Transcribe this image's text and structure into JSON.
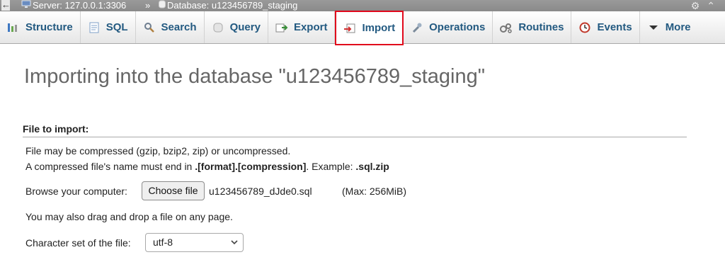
{
  "breadcrumb": {
    "server": "Server: 127.0.0.1:3306",
    "separator": "»",
    "database": "Database: u123456789_staging"
  },
  "tabs": [
    {
      "label": "Structure",
      "icon": "structure-icon"
    },
    {
      "label": "SQL",
      "icon": "sql-icon"
    },
    {
      "label": "Search",
      "icon": "search-icon"
    },
    {
      "label": "Query",
      "icon": "query-icon"
    },
    {
      "label": "Export",
      "icon": "export-icon"
    },
    {
      "label": "Import",
      "icon": "import-icon",
      "active": true
    },
    {
      "label": "Operations",
      "icon": "wrench-icon"
    },
    {
      "label": "Routines",
      "icon": "routines-icon"
    },
    {
      "label": "Events",
      "icon": "clock-icon"
    },
    {
      "label": "More",
      "icon": "chevron-down-icon"
    }
  ],
  "page": {
    "title": "Importing into the database \"u123456789_staging\"",
    "section_label": "File to import:",
    "compress_note": "File may be compressed (gzip, bzip2, zip) or uncompressed.",
    "name_note_prefix": "A compressed file's name must end in ",
    "name_note_format": ".[format].[compression]",
    "name_note_mid": ". Example: ",
    "name_note_example": ".sql.zip",
    "browse_label": "Browse your computer:",
    "choose_button": "Choose file",
    "chosen_file": "u123456789_dJde0.sql",
    "max_size": "(Max: 256MiB)",
    "drag_note": "You may also drag and drop a file on any page.",
    "charset_label": "Character set of the file:",
    "charset_value": "utf-8"
  },
  "colors": {
    "active_tab_border": "#e1091c",
    "tab_text": "#235a81"
  }
}
